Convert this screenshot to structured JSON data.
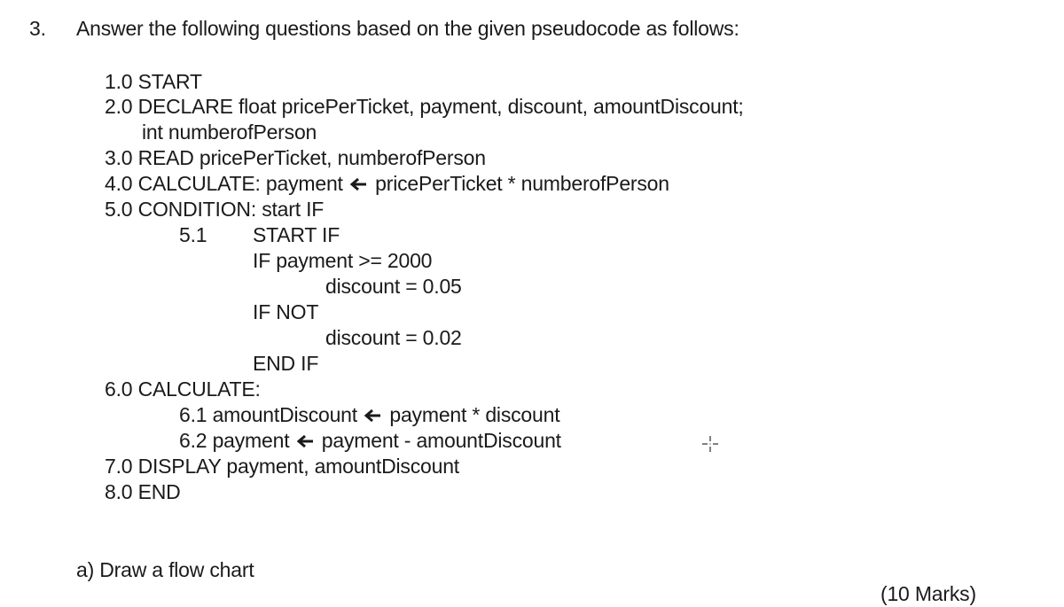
{
  "question": {
    "number": "3.",
    "prompt": "Answer the following questions based on the given pseudocode as follows:"
  },
  "pseudocode": {
    "l1": "1.0 START",
    "l2": "2.0 DECLARE float pricePerTicket, payment, discount, amountDiscount;",
    "l3": "int numberofPerson",
    "l4": "3.0 READ pricePerTicket, numberofPerson",
    "l5a": "4.0 CALCULATE: payment",
    "l5b": "pricePerTicket * numberofPerson",
    "l6": "5.0 CONDITION: start IF",
    "l7num": "5.1",
    "l7": "START IF",
    "l8": "IF payment >= 2000",
    "l9": "discount = 0.05",
    "l10": "IF NOT",
    "l11": "discount = 0.02",
    "l12": "END IF",
    "l13": "6.0 CALCULATE:",
    "l14a": "6.1 amountDiscount",
    "l14b": "payment * discount",
    "l15a": "6.2 payment",
    "l15b": "payment - amountDiscount",
    "l16": "7.0 DISPLAY payment, amountDiscount",
    "l17": "8.0 END"
  },
  "subquestion": {
    "label": "a) Draw a flow chart",
    "marks": "(10 Marks)"
  },
  "icons": {
    "assign_arrow": "left-arrow-icon",
    "cursor": "crosshair-icon"
  }
}
